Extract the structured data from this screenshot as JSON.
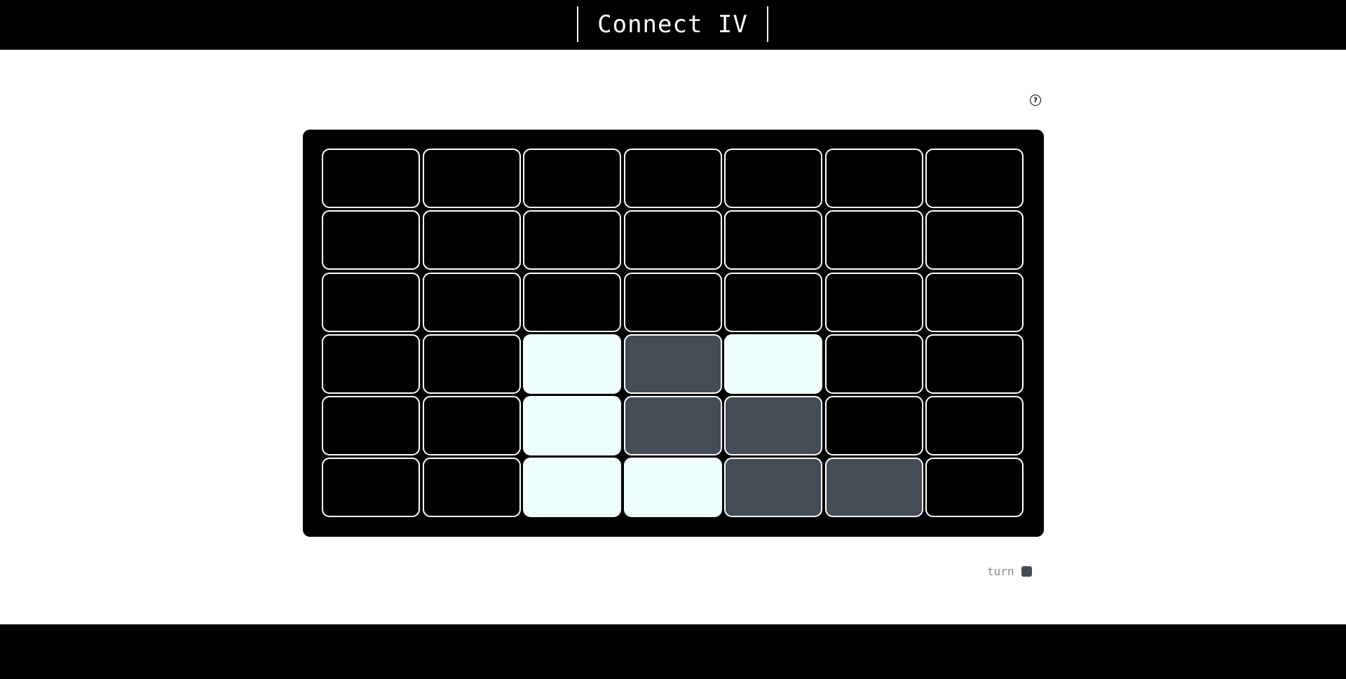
{
  "header": {
    "title": "Connect IV"
  },
  "help": {
    "icon": "question-circle-icon",
    "glyph": "?"
  },
  "colors": {
    "player1": "#eefffe",
    "player2": "#444d55",
    "empty": "#000000",
    "board": "#000000"
  },
  "board": {
    "rows": 6,
    "cols": 7,
    "cells": [
      [
        0,
        0,
        0,
        0,
        0,
        0,
        0
      ],
      [
        0,
        0,
        0,
        0,
        0,
        0,
        0
      ],
      [
        0,
        0,
        0,
        0,
        0,
        0,
        0
      ],
      [
        0,
        0,
        1,
        2,
        1,
        0,
        0
      ],
      [
        0,
        0,
        1,
        2,
        2,
        0,
        0
      ],
      [
        0,
        0,
        1,
        1,
        2,
        2,
        0
      ]
    ]
  },
  "turn": {
    "label": "turn",
    "current_player": 2
  }
}
